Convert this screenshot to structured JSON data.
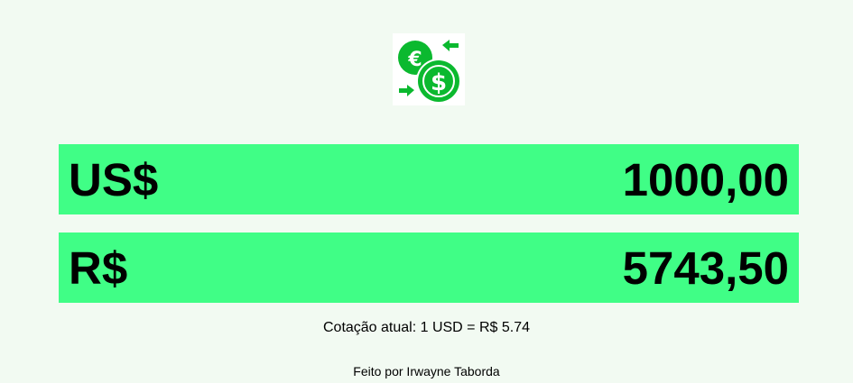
{
  "logo": {
    "icon": "currency-exchange-icon",
    "accent_color": "#0bb92f"
  },
  "usd": {
    "label": "US$",
    "value": "1000,00"
  },
  "brl": {
    "label": "R$",
    "value": "5743,50"
  },
  "rate_text": "Cotação atual: 1 USD = R$ 5.74",
  "footer_text": "Feito por Irwayne Taborda",
  "colors": {
    "background": "#f2faf2",
    "row": "#40fe86"
  }
}
